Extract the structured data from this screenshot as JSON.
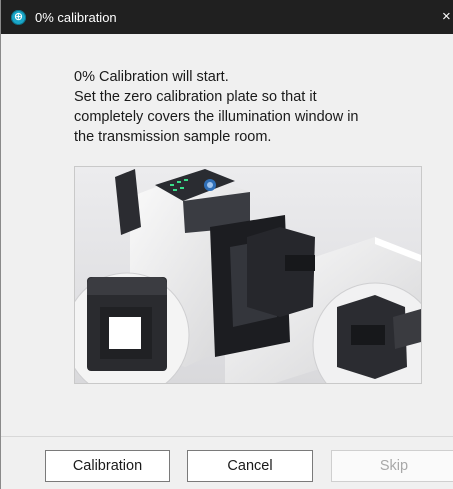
{
  "window": {
    "title": "0% calibration",
    "close_label": "×",
    "icon_glyph": "⊕"
  },
  "message": {
    "lines": [
      "0% Calibration will start.",
      "Set the zero calibration plate so that it",
      "completely covers the illumination window in",
      "the transmission sample room."
    ]
  },
  "buttons": {
    "calibration_label": "Calibration",
    "cancel_label": "Cancel",
    "skip_label": "Skip"
  },
  "colors": {
    "titlebar": "#202020",
    "app_icon": "#1aa6c8",
    "dialog_bg": "#f0f0f0"
  }
}
